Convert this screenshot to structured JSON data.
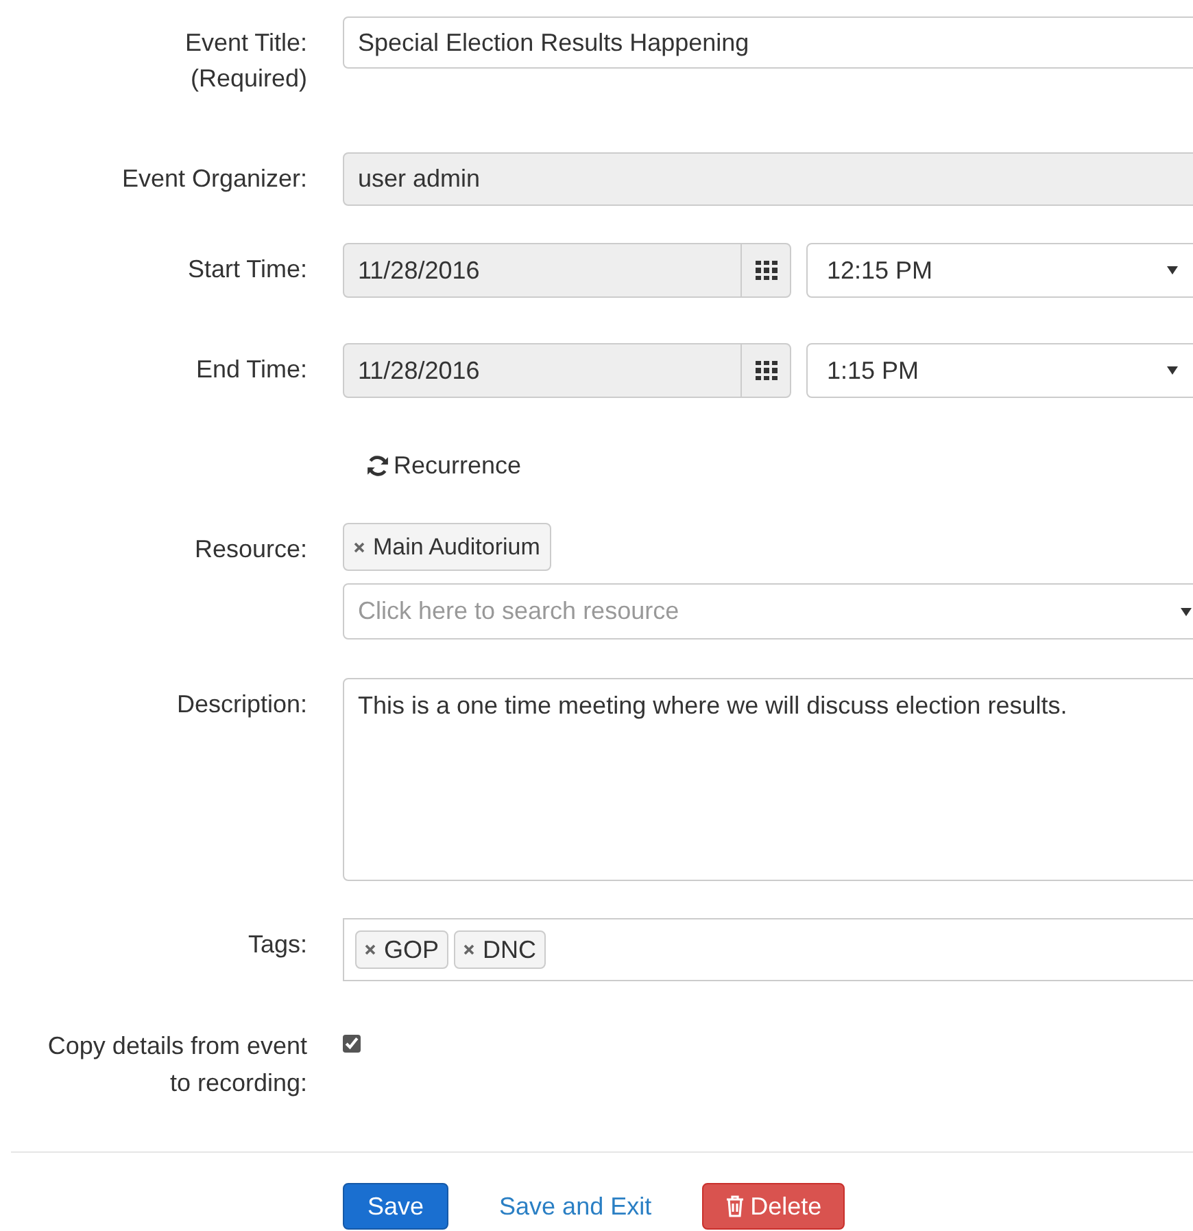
{
  "event_title": {
    "label": "Event Title:",
    "sublabel": "(Required)",
    "value": "Special Election Results Happening"
  },
  "organizer": {
    "label": "Event Organizer:",
    "value": "user admin",
    "disabled": true
  },
  "start": {
    "label": "Start Time:",
    "date": "11/28/2016",
    "time": "12:15 PM"
  },
  "end": {
    "label": "End Time:",
    "date": "11/28/2016",
    "time": "1:15 PM"
  },
  "recurrence": {
    "label": "Recurrence"
  },
  "resource": {
    "label": "Resource:",
    "chips": [
      "Main Auditorium"
    ],
    "placeholder": "Click here to search resource"
  },
  "description": {
    "label": "Description:",
    "value": "This is a one time meeting where we will discuss election results."
  },
  "tags": {
    "label": "Tags:",
    "chips": [
      "GOP",
      "DNC"
    ]
  },
  "copy_details": {
    "label": "Copy details from event to recording:",
    "checked": true
  },
  "buttons": [
    {
      "kind": "primary",
      "label": "Save"
    },
    {
      "kind": "link",
      "label": "Save and Exit"
    },
    {
      "kind": "danger",
      "label": "Delete"
    }
  ]
}
